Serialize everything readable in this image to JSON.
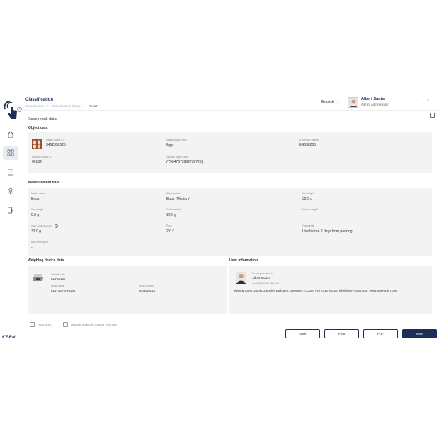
{
  "header": {
    "title": "Classification",
    "breadcrumb": [
      "Classification",
      ">",
      "Classification dialog",
      ">",
      "Result"
    ],
    "language": "English",
    "user_name": "Albert Sauter",
    "user_role": "Admin, Administrator"
  },
  "page_title": "Save result data",
  "object_data": {
    "heading": "Object data",
    "master_id_label": "Master object ID",
    "master_id": "3452352325",
    "master_name_label": "Master object name",
    "master_name": "Eggs",
    "id_number_label": "ID number / Name",
    "id_number": "EG638263",
    "dynamic_id_label": "Dynamic object ID",
    "dynamic_id": "00132",
    "dynamic_name_label": "Dynamic object name",
    "dynamic_name": "Y76347373662736723|"
  },
  "measurement": {
    "heading": "Measurement data",
    "master_class_label": "Master class",
    "master_class": "Eggs",
    "class_applied_label": "Class applied",
    "class_applied": "Eggs (Medium)",
    "net_weight_label": "Net weight",
    "net_weight": "32.0 g",
    "tare_label": "Tare weight",
    "tare": "0.0 g",
    "gross_label": "Gross weight",
    "gross": "32.0 g",
    "manual_label": "Manual weight",
    "manual": "-",
    "total_label": "Total applied weight",
    "total": "32.0 g",
    "price_label": "Price",
    "price": "2.0 €",
    "comments_label": "Comments",
    "comments": "Use before 2 days from packing",
    "alibi_label": "Alibi memory ID",
    "alibi": "-"
  },
  "weighing": {
    "heading": "Weighing device data",
    "internal_code_label": "Internal code",
    "internal_code": "KDP00132",
    "model_label": "Model name",
    "model": "KDP 10K-4-2019a",
    "serial_label": "Serial number",
    "serial": "WD1422012"
  },
  "user_info": {
    "heading": "User information",
    "generated_label": "Result generated by",
    "generated_by": "Albert Sauter",
    "generated_on": "On: 2024-10-04 18:44:29",
    "company": "Kern & Sohn GmbH, Ziegelei, Balingen, Germany, 72336, +49 7433 99330, info@kern-sohn.com, www.kern-sohn.com"
  },
  "options": {
    "auto_print": "Auto print",
    "update_master": "Update object in master memory"
  },
  "buttons": {
    "back": "Back",
    "print": "Print",
    "pdf": "PDF",
    "save": "Save"
  },
  "brand": "KERN",
  "colors": {
    "accent": "#1c2f55",
    "card": "#f3f3f4"
  }
}
